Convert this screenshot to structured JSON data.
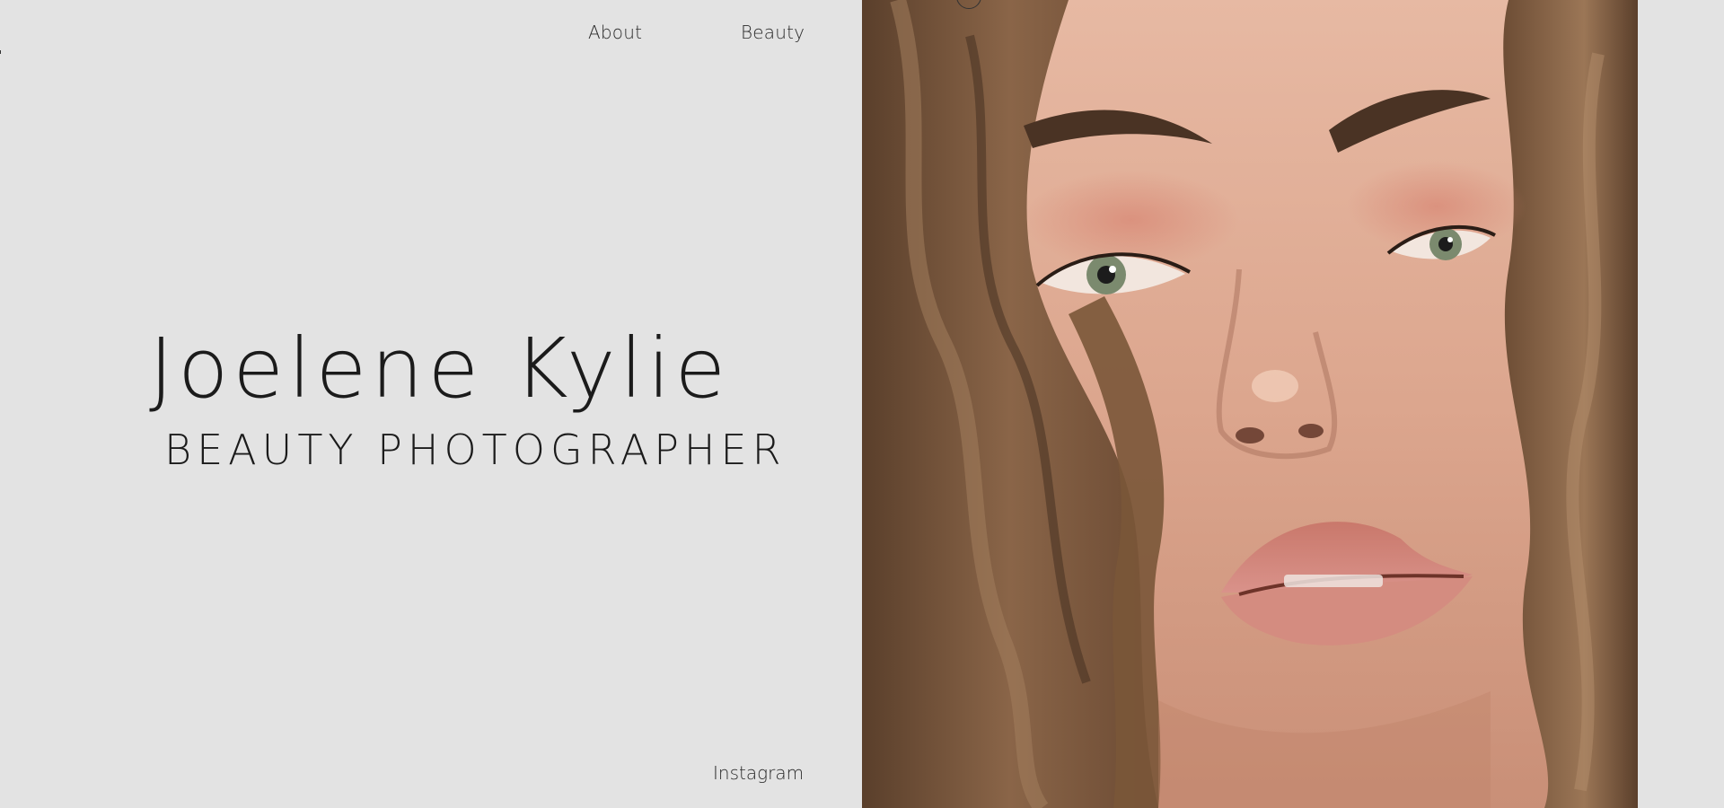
{
  "nav": {
    "about_label": "About",
    "beauty_label": "Beauty"
  },
  "hero": {
    "name": "Joelene Kylie",
    "role": "BEAUTY PHOTOGRAPHER"
  },
  "footer": {
    "instagram_label": "Instagram"
  },
  "colors": {
    "background": "#e3e3e3",
    "text": "#1b1b1b"
  }
}
